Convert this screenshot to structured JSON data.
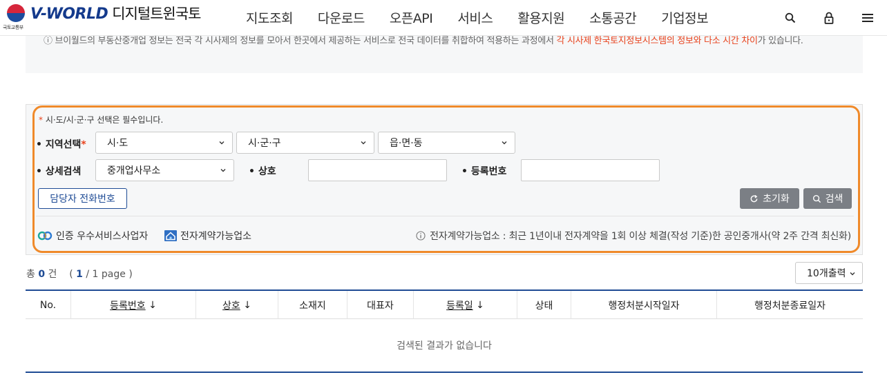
{
  "header": {
    "gov_name": "국토교통부",
    "brand": "V-WORLD",
    "brand_kr": "디지털트윈국토",
    "menu": [
      "지도조회",
      "다운로드",
      "오픈API",
      "서비스",
      "활용지원",
      "소통공간",
      "기업정보"
    ],
    "icons": [
      "search-icon",
      "lock-icon",
      "menu-icon"
    ]
  },
  "notice": {
    "text": "ⓘ 브이월드의 부동산중개업 정보는 전국 각 시사제의 정보를 모아서 한곳에서 제공하는 서비스로 전국 데이터를 취합하여 적용하는 과정에서 ",
    "highlight": "각 시사제 한국토지정보시스템의 정보와 다소 시간 차이",
    "tail": "가 있습니다."
  },
  "search": {
    "required_note": "시·도/시·군·구 선택은 필수입니다.",
    "region_label": "지역선택",
    "sido": "시·도",
    "sigungu": "시·군·구",
    "eupmyeondong": "읍·면·동",
    "detail_label": "상세검색",
    "detail_type": "중개업사무소",
    "name_label": "상호",
    "regno_label": "등록번호",
    "call_button": "담당자 전화번호",
    "reset_button": "초기화",
    "search_button": "검색",
    "legend_certified": "인증 우수서비스사업자",
    "legend_econtract": "전자계약가능업소",
    "info_text": "전자계약가능업소 : 최근 1년이내 전자계약을 1회 이상 체결(작성 기준)한 공인중개사(약 2주 간격 최신화)"
  },
  "results": {
    "total_prefix": "총",
    "total": "0",
    "total_suffix": "건",
    "page_open": "(",
    "page_current": "1",
    "page_rest": "/ 1 page",
    "page_close": ")",
    "per_page": "10개출력",
    "columns": [
      "No.",
      "등록번호",
      "상호",
      "소재지",
      "대표자",
      "등록일",
      "상태",
      "행정처분시작일자",
      "행정처분종료일자"
    ],
    "empty_message": "검색된 결과가 없습니다"
  },
  "colors": {
    "brand_blue": "#1d4a94",
    "highlight_orange": "#f08a2a",
    "notice_red": "#e8421c"
  }
}
